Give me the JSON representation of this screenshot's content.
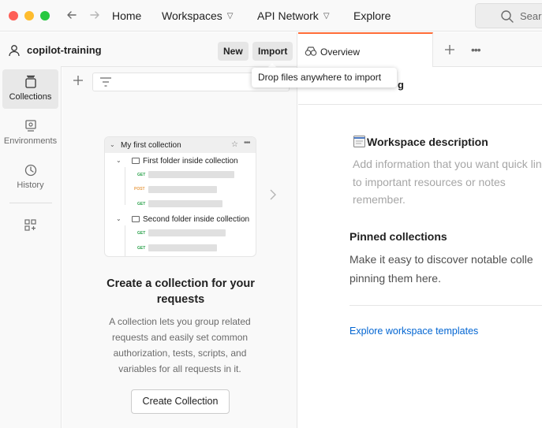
{
  "window": {
    "traffic_lights": [
      "close",
      "minimize",
      "zoom"
    ],
    "colors": {
      "close": "#fe5f57",
      "minimize": "#febc2e",
      "zoom": "#28c840"
    }
  },
  "topnav": {
    "home": "Home",
    "workspaces": "Workspaces",
    "api_network": "API Network",
    "explore": "Explore",
    "search_placeholder": "Search"
  },
  "workspace": {
    "name": "copilot-training",
    "new_label": "New",
    "import_label": "Import"
  },
  "tooltip": {
    "text": "Drop files anywhere to import"
  },
  "rail": {
    "items": [
      {
        "label": "Collections",
        "icon": "collections-icon",
        "active": true
      },
      {
        "label": "Environments",
        "icon": "environments-icon",
        "active": false
      },
      {
        "label": "History",
        "icon": "history-icon",
        "active": false
      }
    ],
    "extra_icon": "add-widgets-icon"
  },
  "sidebar": {
    "illustration": {
      "collection": "My first collection",
      "folder1": "First folder inside collection",
      "folder2": "Second folder inside collection",
      "methods": [
        "GET",
        "POST",
        "GET",
        "GET",
        "GET"
      ]
    },
    "empty_title": "Create a collection for your requests",
    "empty_desc": "A collection lets you group related requests and easily set common authorization, tests, scripts, and variables for all requests in it.",
    "create_button": "Create Collection"
  },
  "tabs": {
    "overview_label": "Overview"
  },
  "main": {
    "header_partial": "g",
    "desc_title": "Workspace description",
    "desc_placeholder": "Add information that you want quick links to important resources or notes remember.",
    "pinned_title": "Pinned collections",
    "pinned_desc": "Make it easy to discover notable colle pinning them here.",
    "templates_link": "Explore workspace templates"
  },
  "accent": {
    "tab_active": "#ff6c37",
    "link": "#0265d2"
  }
}
